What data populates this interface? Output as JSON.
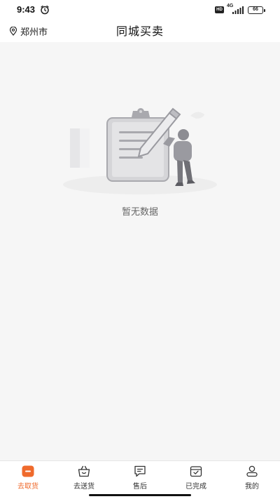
{
  "status_bar": {
    "time": "9:43",
    "hd_badge": "HD",
    "network_label": "4G",
    "battery_level": "66",
    "icons": [
      "alarm-icon",
      "signal-icon",
      "battery-icon"
    ]
  },
  "header": {
    "location": "郑州市",
    "location_icon": "location-pin-icon",
    "title": "同城买卖"
  },
  "empty_state": {
    "message": "暂无数据",
    "illustration": "clipboard-pencil-person-illustration"
  },
  "tabbar": {
    "active_color": "#ef6a2c",
    "items": [
      {
        "label": "去取货",
        "icon": "pickup-box-icon",
        "active": true
      },
      {
        "label": "去送货",
        "icon": "delivery-basket-icon",
        "active": false
      },
      {
        "label": "售后",
        "icon": "message-icon",
        "active": false
      },
      {
        "label": "已完成",
        "icon": "completed-check-icon",
        "active": false
      },
      {
        "label": "我的",
        "icon": "user-icon",
        "active": false
      }
    ]
  }
}
